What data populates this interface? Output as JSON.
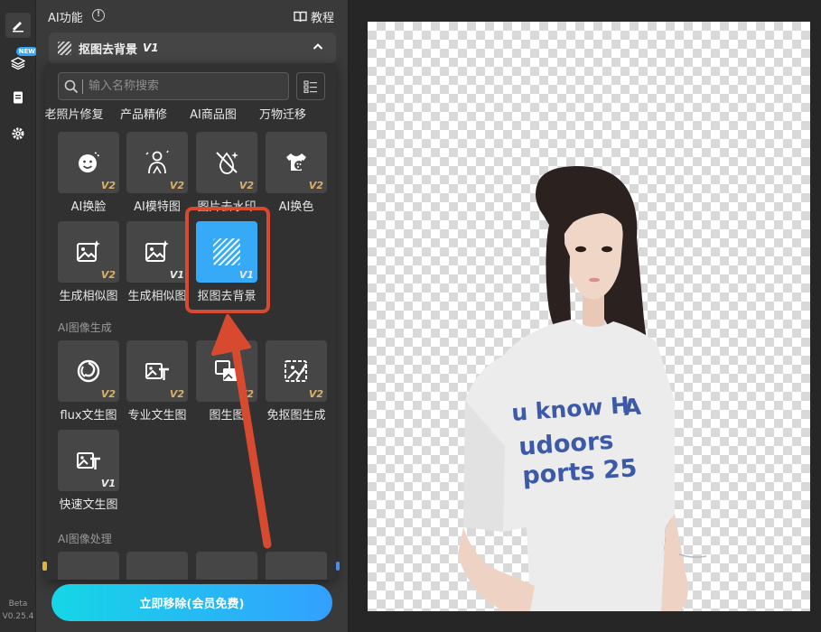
{
  "rail": {
    "new_badge": "NEW",
    "beta_label": "Beta",
    "version_label": "V0.25.4"
  },
  "panel": {
    "title": "AI功能",
    "tutorial_label": "教程",
    "selected_feature": "抠图去背景",
    "selected_version": "V1"
  },
  "popup": {
    "search_placeholder": "输入名称搜索",
    "top_row": [
      "老照片修复",
      "产品精修",
      "AI商品图",
      "万物迁移"
    ],
    "row1": [
      {
        "label": "AI换脸",
        "version": "V2",
        "icon": "face-icon"
      },
      {
        "label": "AI模特图",
        "version": "V2",
        "icon": "model-icon"
      },
      {
        "label": "图片去水印",
        "version": "V2",
        "icon": "remove-watermark-icon"
      },
      {
        "label": "AI换色",
        "version": "V2",
        "icon": "shirt-color-icon"
      }
    ],
    "row2": [
      {
        "label": "生成相似图",
        "version": "V2",
        "icon": "image-sparkle-icon"
      },
      {
        "label": "生成相似图",
        "version": "V1",
        "icon": "image-sparkle-icon"
      },
      {
        "label": "抠图去背景",
        "version": "V1",
        "icon": "cutout-icon"
      }
    ],
    "section_generate": "AI图像生成",
    "row3": [
      {
        "label": "flux文生图",
        "version": "V2",
        "icon": "flux-icon"
      },
      {
        "label": "专业文生图",
        "version": "V2",
        "icon": "text-to-image-icon"
      },
      {
        "label": "图生图",
        "version": "V2",
        "icon": "image-to-image-icon"
      },
      {
        "label": "免抠图生成",
        "version": "V2",
        "icon": "no-cutout-icon"
      }
    ],
    "row4": [
      {
        "label": "快速文生图",
        "version": "V1",
        "icon": "text-to-image-icon"
      }
    ],
    "section_process": "AI图像处理"
  },
  "cta_label": "立即移除(会员免费)",
  "canvas": {
    "shirt_lines": [
      "u know H",
      "A",
      "udoors",
      "ports 25"
    ]
  },
  "colors": {
    "accent": "#36a9f7",
    "highlight": "#d84a2f",
    "version_gold": "#d9b06a"
  }
}
